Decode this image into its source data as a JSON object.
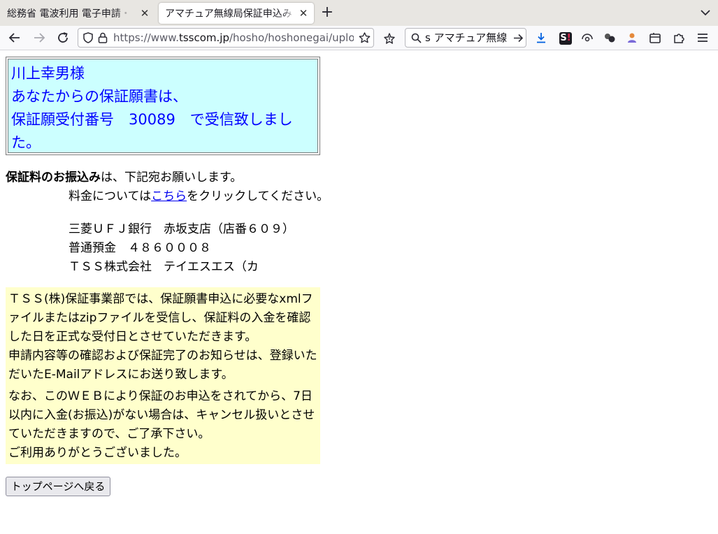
{
  "browser": {
    "tabs": [
      {
        "title": "総務省 電波利用 電子申請・届出システム"
      },
      {
        "title": "アマチュア無線局保証申込み"
      }
    ],
    "url": {
      "prefix": "https://www.",
      "host": "tsscom.jp",
      "path": "/hosho/hoshonegai/upload"
    },
    "search": {
      "value": "s アマチュア無線"
    }
  },
  "message": {
    "lines": [
      "川上幸男様",
      "あなたからの保証願書は、",
      "保証願受付番号　30089　で受信致しまし",
      "た。"
    ]
  },
  "payment": {
    "bold": "保証料のお振込み",
    "rest": "は、下記宛お願いします。",
    "fee_prefix": "料金については",
    "fee_link": "こちら",
    "fee_suffix": "をクリックしてください。"
  },
  "bank": {
    "name": "三菱ＵＦＪ銀行　赤坂支店（店番６０９）",
    "account": "普通預金　４８６０００８",
    "holder": "ＴＳＳ株式会社　テイエスエス（カ"
  },
  "notice": {
    "p1": "ＴＳＳ(株)保証事業部では、保証願書申込に必要なxmlファイルまたはzipファイルを受信し、保証料の入金を確認した日を正式な受付日とさせていただきます。",
    "p2": "申請内容等の確認および保証完了のお知らせは、登録いただいたE-Mailアドレスにお送り致します。",
    "p3": "なお、このＷＥＢにより保証のお申込をされてから、7日以内に入金(お振込)がない場合は、キャンセル扱いとさせていただきますので、ご了承下さい。",
    "p4": "ご利用ありがとうございました。"
  },
  "button": {
    "label": "トップページへ戻る"
  }
}
